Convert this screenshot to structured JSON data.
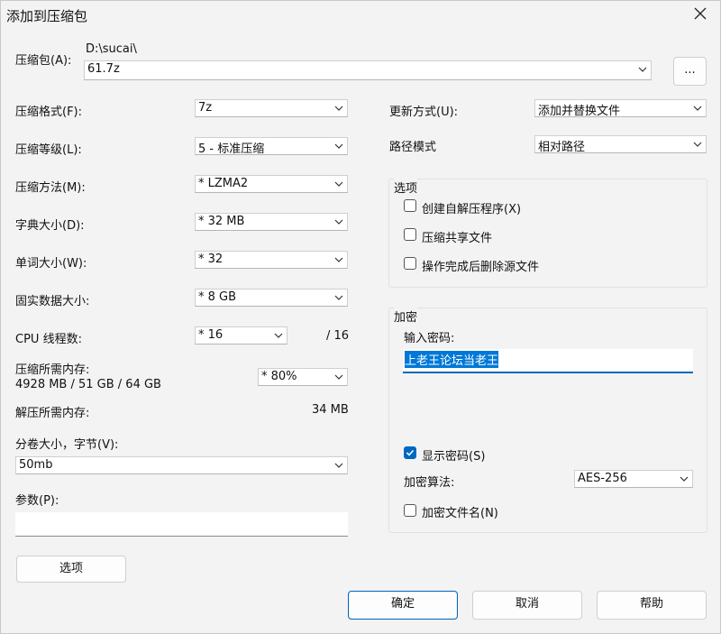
{
  "window": {
    "title": "添加到压缩包"
  },
  "archive": {
    "label": "压缩包(A):",
    "path": "D:\\sucai\\",
    "name": "61.7z",
    "browse_label": "..."
  },
  "left_fields": [
    {
      "label": "压缩格式(F):",
      "value": "7z"
    },
    {
      "label": "压缩等级(L):",
      "value": "5 - 标准压缩"
    },
    {
      "label": "压缩方法(M):",
      "value": "*  LZMA2"
    },
    {
      "label": "字典大小(D):",
      "value": "*  32 MB"
    },
    {
      "label": "单词大小(W):",
      "value": "*  32"
    },
    {
      "label": "固实数据大小:",
      "value": "*  8 GB"
    }
  ],
  "cpu": {
    "label": "CPU 线程数:",
    "value": "*  16",
    "max": "/ 16"
  },
  "memory": {
    "compress_label": "压缩所需内存:",
    "compress_value": "4928 MB / 51 GB / 64 GB",
    "percent": "*  80%",
    "decompress_label": "解压所需内存:",
    "decompress_value": "34 MB"
  },
  "split": {
    "label": "分卷大小，字节(V):",
    "value": "50mb"
  },
  "params": {
    "label": "参数(P):",
    "value": ""
  },
  "options_button": "选项",
  "update_mode": {
    "label": "更新方式(U):",
    "value": "添加并替换文件"
  },
  "path_mode": {
    "label": "路径模式",
    "value": "相对路径"
  },
  "options_group": {
    "title": "选项",
    "items": [
      {
        "label": "创建自解压程序(X)",
        "checked": false
      },
      {
        "label": "压缩共享文件",
        "checked": false
      },
      {
        "label": "操作完成后删除源文件",
        "checked": false
      }
    ]
  },
  "encryption": {
    "title": "加密",
    "password_label": "输入密码:",
    "password_value": "上老王论坛当老王",
    "show_password_label": "显示密码(S)",
    "show_password_checked": true,
    "method_label": "加密算法:",
    "method_value": "AES-256",
    "encrypt_names_label": "加密文件名(N)",
    "encrypt_names_checked": false
  },
  "buttons": {
    "ok": "确定",
    "cancel": "取消",
    "help": "帮助"
  },
  "colors": {
    "accent": "#0067c0",
    "selection": "#0078d7"
  }
}
